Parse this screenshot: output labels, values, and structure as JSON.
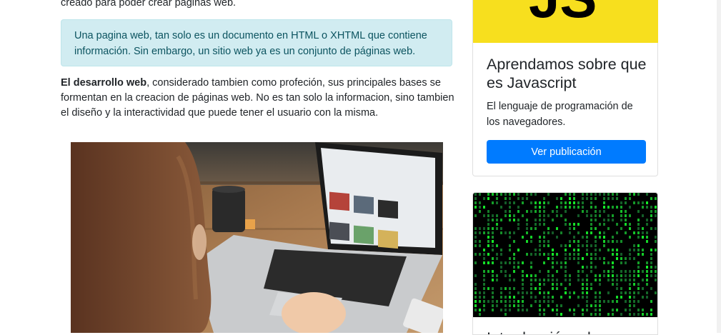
{
  "main": {
    "intro_tail": "creado para poder crear páginas web.",
    "alert_text": "Una pagina web, tan solo es un documento en HTML o XHTML que contiene información. Sin embargo, un sitio web ya es un conjunto de páginas web.",
    "paragraph_bold": "El desarrollo web",
    "paragraph_rest": ", considerado tambien como profeción, sus principales bases se formentan en la creacion de páginas web. No es tan solo la informacion, sino tambien el diseño y la interactividad que puede tener el usuario con la misma."
  },
  "sidebar": {
    "card1": {
      "logo_text": "JS",
      "title": "Aprendamos sobre que es Javascript",
      "text": "El lenguaje de programación de los navegadores.",
      "button_label": "Ver publicación"
    },
    "card2": {
      "title": "Introducción a la programación"
    }
  },
  "colors": {
    "alert_bg": "#d1ecf1",
    "alert_text": "#0c5460",
    "button": "#007bff",
    "js_yellow": "#f7df1e"
  }
}
